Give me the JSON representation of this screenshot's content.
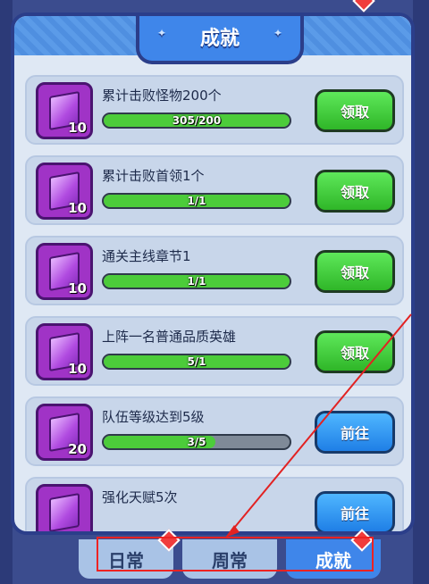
{
  "title": "成就",
  "tasks": [
    {
      "text": "累计击败怪物200个",
      "progress_text": "305/200",
      "progress": 1.0,
      "reward": "10",
      "button": "领取",
      "button_type": "green"
    },
    {
      "text": "累计击败首领1个",
      "progress_text": "1/1",
      "progress": 1.0,
      "reward": "10",
      "button": "领取",
      "button_type": "green"
    },
    {
      "text": "通关主线章节1",
      "progress_text": "1/1",
      "progress": 1.0,
      "reward": "10",
      "button": "领取",
      "button_type": "green"
    },
    {
      "text": "上阵一名普通品质英雄",
      "progress_text": "5/1",
      "progress": 1.0,
      "reward": "10",
      "button": "领取",
      "button_type": "green"
    },
    {
      "text": "队伍等级达到5级",
      "progress_text": "3/5",
      "progress": 0.6,
      "reward": "20",
      "button": "前往",
      "button_type": "blue"
    },
    {
      "text": "强化天赋5次",
      "progress_text": "",
      "progress": 0.0,
      "reward": "",
      "button": "前往",
      "button_type": "blue"
    }
  ],
  "tabs": [
    "日常",
    "周常",
    "成就"
  ],
  "active_tab": 2,
  "colors": {
    "accent_blue": "#3f86ea",
    "green_button": "#2fb628",
    "progress_fill": "#4ccc3a",
    "annotation_red": "#e22222"
  }
}
